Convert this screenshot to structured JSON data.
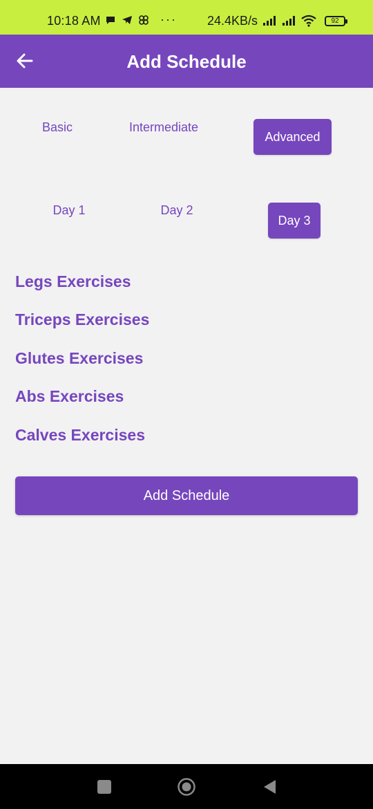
{
  "status_bar": {
    "time": "10:18 AM",
    "dots": "···",
    "network_speed": "24.4KB/s",
    "battery": "92"
  },
  "app_bar": {
    "title": "Add Schedule",
    "back_icon": "arrow-left-icon"
  },
  "levels": [
    {
      "label": "Basic",
      "active": false
    },
    {
      "label": "Intermediate",
      "active": false
    },
    {
      "label": "Advanced",
      "active": true
    }
  ],
  "days": [
    {
      "label": "Day 1",
      "active": false
    },
    {
      "label": "Day 2",
      "active": false
    },
    {
      "label": "Day 3",
      "active": true
    }
  ],
  "exercises": [
    {
      "label": "Legs Exercises"
    },
    {
      "label": "Triceps Exercises"
    },
    {
      "label": "Glutes Exercises"
    },
    {
      "label": "Abs Exercises"
    },
    {
      "label": "Calves Exercises"
    }
  ],
  "add_button": {
    "label": "Add Schedule"
  },
  "colors": {
    "primary": "#7646bd",
    "status_bar": "#c8ef3f",
    "background": "#f2f2f3"
  }
}
